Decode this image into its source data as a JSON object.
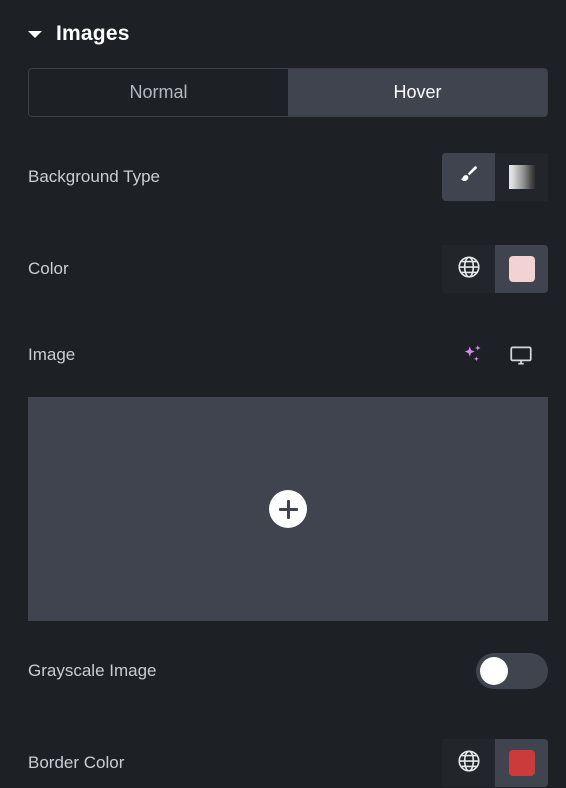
{
  "section": {
    "title": "Images",
    "collapse_icon": "caret-down-icon",
    "expanded": true
  },
  "tabs": [
    {
      "label": "Normal",
      "active": false
    },
    {
      "label": "Hover",
      "active": true
    }
  ],
  "rows": {
    "background_type": {
      "label": "Background Type",
      "options": [
        {
          "icon": "paintbrush-icon",
          "selected": true
        },
        {
          "icon": "gradient-icon",
          "selected": false
        }
      ]
    },
    "color": {
      "label": "Color",
      "global_icon": "globe-icon",
      "swatch_value": "#f2d2d2"
    },
    "image": {
      "label": "Image",
      "ai_icon": "sparkles-ai-icon",
      "device_icon": "monitor-desktop-icon",
      "dropzone_icon": "plus-circle-icon"
    },
    "grayscale_image": {
      "label": "Grayscale Image",
      "toggle_state": "off"
    },
    "border_color": {
      "label": "Border Color",
      "global_icon": "globe-icon",
      "swatch_value": "#cc3b3b"
    }
  },
  "colors": {
    "page_background": "#1d2125",
    "panel_background": "#3f444e",
    "control_dark": "#22262b",
    "text_primary": "#ffffff",
    "text_secondary": "#c9ced4",
    "accent_ai": "#d48ae8"
  }
}
